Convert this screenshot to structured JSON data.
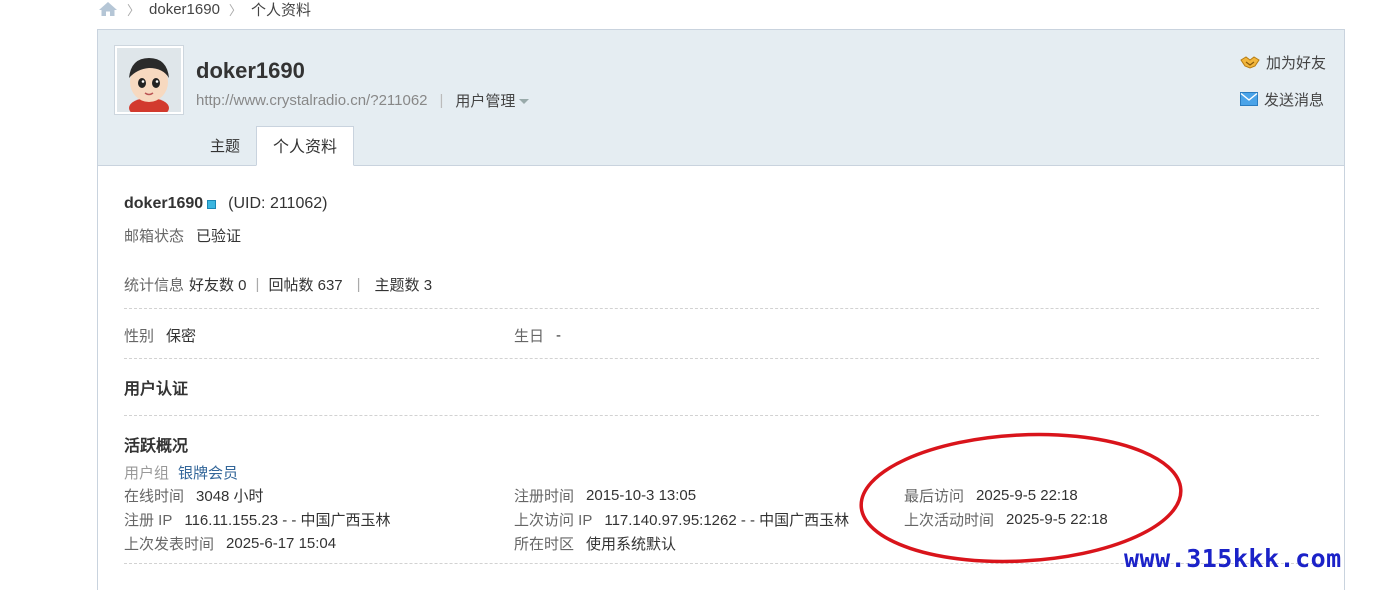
{
  "breadcrumb": {
    "items": [
      "doker1690",
      "个人资料"
    ]
  },
  "header": {
    "username": "doker1690",
    "url": "http://www.crystalradio.cn/?211062",
    "manage_label": "用户管理",
    "actions": {
      "add_friend": "加为好友",
      "send_message": "发送消息"
    },
    "tabs": [
      {
        "label": "主题"
      },
      {
        "label": "个人资料",
        "active": true
      }
    ]
  },
  "profile": {
    "name": "doker1690",
    "uid": "(UID: 211062)",
    "email_label": "邮箱状态",
    "email_value": "已验证",
    "stats_label": "统计信息",
    "friends": "好友数 0",
    "replies": "回帖数 637",
    "threads": "主题数 3",
    "gender_label": "性别",
    "gender_value": "保密",
    "birthday_label": "生日",
    "birthday_value": "-",
    "auth_title": "用户认证",
    "activity_title": "活跃概况",
    "group_label": "用户组",
    "group_value": "银牌会员",
    "online_label": "在线时间",
    "online_value": "3048 小时",
    "reg_time_label": "注册时间",
    "reg_time_value": "2015-10-3 13:05",
    "last_visit_label": "最后访问",
    "last_visit_value": "2025-9-5 22:18",
    "reg_ip_label": "注册 IP",
    "reg_ip_value": "116.11.155.23 - - 中国广西玉林",
    "last_ip_label": "上次访问 IP",
    "last_ip_value": "117.140.97.95:1262 - - 中国广西玉林",
    "last_active_label": "上次活动时间",
    "last_active_value": "2025-9-5 22:18",
    "last_post_label": "上次发表时间",
    "last_post_value": "2025-6-17 15:04",
    "timezone_label": "所在时区",
    "timezone_value": "使用系统默认"
  },
  "watermark": "www.315kkk.com",
  "colors": {
    "header_bg": "#e5edf2",
    "link": "#336699",
    "annotation": "#d9141b",
    "watermark": "#1b22c8"
  }
}
